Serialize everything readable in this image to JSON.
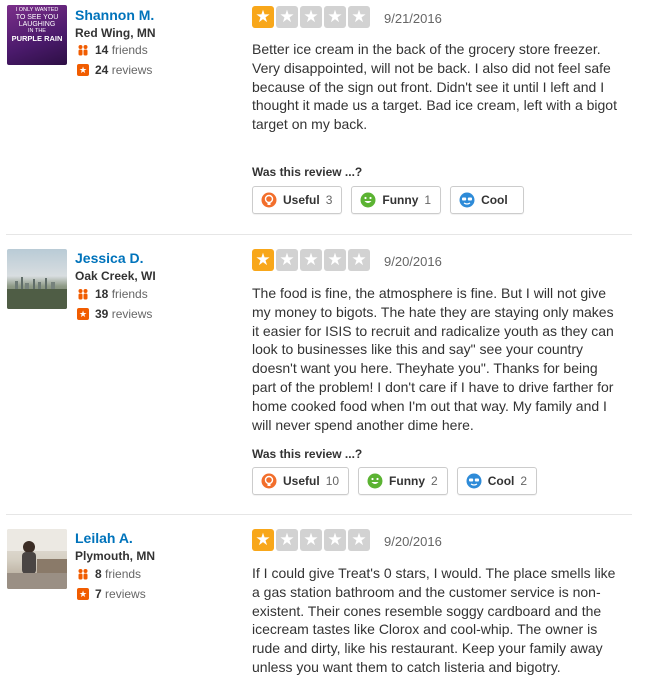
{
  "vote_prompt": "Was this review ...?",
  "colors": {
    "star_on": "#f8a71a",
    "star_off": "#d2d2d2",
    "link": "#0073bb",
    "reviews_badge": "#f15c00"
  },
  "reviews": [
    {
      "user": {
        "name": "Shannon M.",
        "location": "Red Wing, MN",
        "friends": "14",
        "friends_label": "friends",
        "reviews": "24",
        "reviews_label": "reviews",
        "avatar_text": [
          "I ONLY WANTED",
          "TO SEE YOU",
          "LAUGHING",
          "IN THE",
          "PURPLE RAIN"
        ]
      },
      "rating": 1,
      "date": "9/21/2016",
      "text": "Better ice cream in the back of the grocery store freezer. Very disappointed, will not be back. I also did not feel safe because of the sign out front. Didn't see it until I left and I thought it made us a target. Bad ice cream, left with a bigot target on my back.",
      "votes": {
        "useful_label": "Useful",
        "useful": "3",
        "funny_label": "Funny",
        "funny": "1",
        "cool_label": "Cool",
        "cool": ""
      }
    },
    {
      "user": {
        "name": "Jessica D.",
        "location": "Oak Creek, WI",
        "friends": "18",
        "friends_label": "friends",
        "reviews": "39",
        "reviews_label": "reviews"
      },
      "rating": 1,
      "date": "9/20/2016",
      "text": "The food is fine, the atmosphere is fine. But I will not give my money to bigots. The hate they are staying only makes it easier for ISIS to recruit and radicalize youth as they can look to businesses like this and say\" see your country doesn't want you here. Theyhate you\". Thanks for being part of the problem! I don't care if I have to drive farther for home cooked food when I'm out that way. My family and I will never spend another dime here.",
      "votes": {
        "useful_label": "Useful",
        "useful": "10",
        "funny_label": "Funny",
        "funny": "2",
        "cool_label": "Cool",
        "cool": "2"
      }
    },
    {
      "user": {
        "name": "Leilah A.",
        "location": "Plymouth, MN",
        "friends": "8",
        "friends_label": "friends",
        "reviews": "7",
        "reviews_label": "reviews"
      },
      "rating": 1,
      "date": "9/20/2016",
      "text": "If I could give Treat's 0 stars, I would. The place smells like a gas station bathroom and the customer service is non-existent. Their cones resemble soggy cardboard and the icecream tastes like Clorox and cool-whip. The owner is rude and dirty, like his restaurant. Keep your family away unless you want them to catch listeria and bigotry."
    }
  ]
}
